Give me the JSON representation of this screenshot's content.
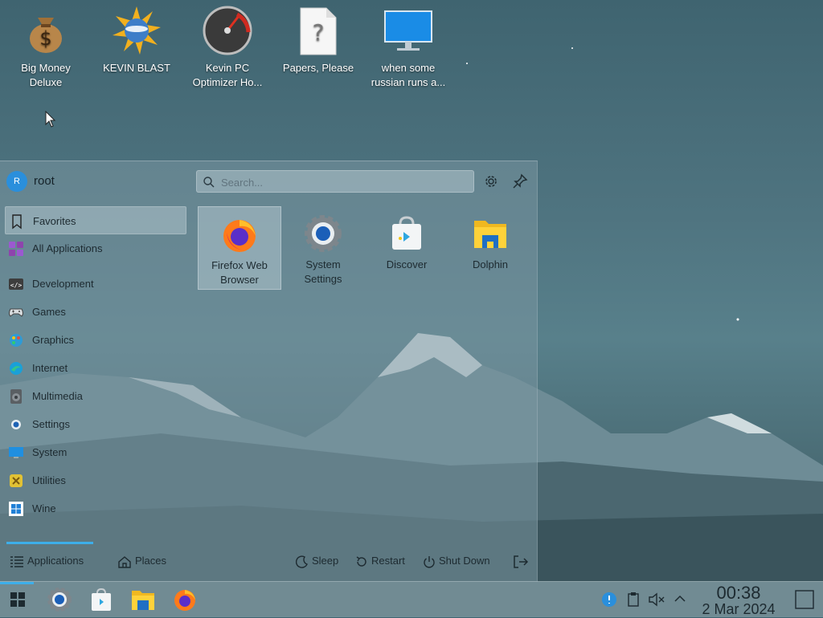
{
  "desktop": {
    "icons": [
      {
        "label": "Big Money\nDeluxe",
        "line1": "Big Money",
        "line2": "Deluxe",
        "icon": "money-bag-icon"
      },
      {
        "label": "KEVIN BLAST",
        "line1": "KEVIN BLAST",
        "line2": "",
        "icon": "starburst-globe-icon"
      },
      {
        "label": "Kevin PC Optimizer Ho...",
        "line1": "Kevin PC",
        "line2": "Optimizer Ho...",
        "icon": "gauge-icon"
      },
      {
        "label": "Papers, Please",
        "line1": "Papers, Please",
        "line2": "",
        "icon": "unknown-file-icon"
      },
      {
        "label": "when some russian runs a...",
        "line1": "when some",
        "line2": "russian runs a...",
        "icon": "monitor-icon"
      }
    ]
  },
  "menu": {
    "user": {
      "initial": "R",
      "name": "root"
    },
    "search": {
      "placeholder": "Search..."
    },
    "categories": [
      {
        "label": "Favorites",
        "icon": "bookmark-icon",
        "selected": true
      },
      {
        "label": "All Applications",
        "icon": "grid-icon"
      },
      {
        "label": "Development",
        "icon": "code-icon"
      },
      {
        "label": "Games",
        "icon": "gamepad-icon"
      },
      {
        "label": "Graphics",
        "icon": "paint-icon"
      },
      {
        "label": "Internet",
        "icon": "globe-icon"
      },
      {
        "label": "Multimedia",
        "icon": "speaker-icon"
      },
      {
        "label": "Settings",
        "icon": "settings-icon"
      },
      {
        "label": "System",
        "icon": "system-icon"
      },
      {
        "label": "Utilities",
        "icon": "utilities-icon"
      },
      {
        "label": "Wine",
        "icon": "wine-icon"
      }
    ],
    "favorites": [
      {
        "line1": "Firefox Web",
        "line2": "Browser",
        "icon": "firefox-icon",
        "selected": true
      },
      {
        "line1": "System",
        "line2": "Settings",
        "icon": "system-settings-icon"
      },
      {
        "line1": "Discover",
        "line2": "",
        "icon": "discover-icon"
      },
      {
        "line1": "Dolphin",
        "line2": "",
        "icon": "dolphin-folder-icon"
      }
    ],
    "footer": {
      "applications": "Applications",
      "places": "Places",
      "sleep": "Sleep",
      "restart": "Restart",
      "shutdown": "Shut Down"
    }
  },
  "taskbar": {
    "clock": {
      "time": "00:38",
      "date": "2 Mar 2024"
    }
  },
  "colors": {
    "accent": "#3daee9"
  }
}
